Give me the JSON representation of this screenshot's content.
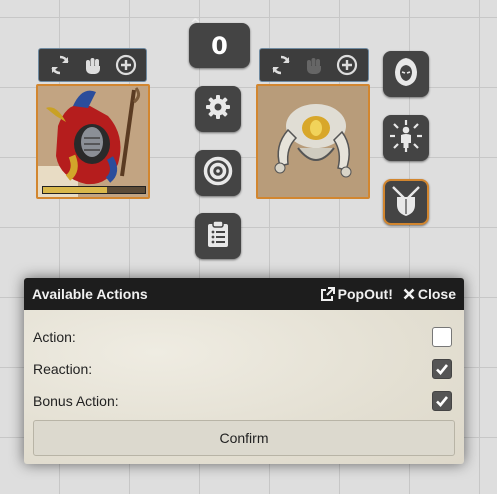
{
  "counter": {
    "value": "0",
    "caret": "^"
  },
  "token_bars": [
    {
      "icons": [
        "rotate-icon",
        "fist-icon",
        "plus-circle-icon"
      ]
    },
    {
      "icons": [
        "rotate-icon",
        "fist-icon",
        "plus-circle-icon"
      ]
    }
  ],
  "tokens": [
    {
      "name": "jester-wizard-token",
      "hp_fraction": 0.63
    },
    {
      "name": "golden-armored-creature-token"
    }
  ],
  "center_buttons": [
    "gear-icon",
    "target-icon",
    "clipboard-icon"
  ],
  "side_buttons": [
    "hooded-figure-icon",
    "radiant-figure-icon",
    "crossed-swords-shield-icon"
  ],
  "dialog": {
    "title": "Available Actions",
    "popout_label": "PopOut!",
    "close_label": "Close",
    "rows": [
      {
        "label": "Action:",
        "checked": false
      },
      {
        "label": "Reaction:",
        "checked": true
      },
      {
        "label": "Bonus Action:",
        "checked": true
      }
    ],
    "confirm_label": "Confirm"
  },
  "colors": {
    "token_border": "#d2862f",
    "bar_border": "#6f8aa0",
    "button_bg": "#444444",
    "dialog_header": "#1d1d1d"
  }
}
